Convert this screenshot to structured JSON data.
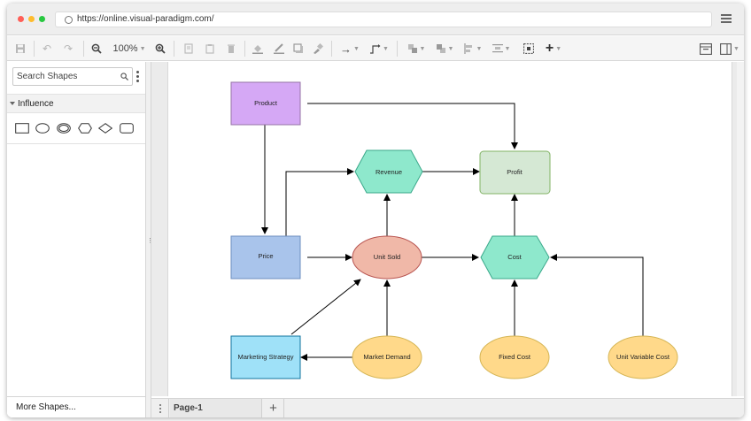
{
  "browser": {
    "url": "https://online.visual-paradigm.com/",
    "dot_colors": [
      "#ff5f57",
      "#febc2e",
      "#28c840"
    ]
  },
  "toolbar": {
    "zoom_level": "100%",
    "icons": [
      "save-icon",
      "undo-icon",
      "redo-icon",
      "zoom-out-icon",
      "zoom-in-icon",
      "copy-icon",
      "paste-icon",
      "delete-icon",
      "fill-color-icon",
      "line-color-icon",
      "shadow-icon",
      "format-painter-icon",
      "connector-icon",
      "waypoint-icon",
      "to-front-icon",
      "to-back-icon",
      "align-icon",
      "distribute-icon",
      "select-all-icon",
      "insert-icon",
      "format-panel-icon",
      "outline-panel-icon"
    ]
  },
  "sidebar": {
    "search_placeholder": "Search Shapes",
    "section_title": "Influence",
    "palette_shapes": [
      "rectangle",
      "ellipse",
      "double-ellipse",
      "hexagon",
      "diamond",
      "rounded-rectangle"
    ],
    "more_shapes_label": "More Shapes..."
  },
  "pages": {
    "tabs": [
      {
        "label": "Page-1"
      }
    ],
    "add_label": "+"
  },
  "diagram": {
    "colors": {
      "product": "#d5a8f5",
      "product_stroke": "#9673a6",
      "revenue": "#8ee8cc",
      "revenue_stroke": "#3aa88a",
      "profit": "#d5e8d4",
      "profit_stroke": "#82b366",
      "price": "#a9c4eb",
      "price_stroke": "#6c8ebf",
      "unit_sold": "#f0b8a8",
      "unit_sold_stroke": "#b85450",
      "cost": "#8ee8cc",
      "cost_stroke": "#3aa88a",
      "marketing": "#9fe1f8",
      "marketing_stroke": "#10739e",
      "yellow": "#ffd98a",
      "yellow_stroke": "#d6b656"
    },
    "nodes": [
      {
        "id": "product",
        "label": "Product"
      },
      {
        "id": "revenue",
        "label": "Revenue"
      },
      {
        "id": "profit",
        "label": "Profit"
      },
      {
        "id": "price",
        "label": "Price"
      },
      {
        "id": "unit_sold",
        "label": "Unit Sold"
      },
      {
        "id": "cost",
        "label": "Cost"
      },
      {
        "id": "marketing",
        "label": "Marketing Strategy"
      },
      {
        "id": "market_demand",
        "label": "Market Demand"
      },
      {
        "id": "fixed_cost",
        "label": "Fixed Cost"
      },
      {
        "id": "unit_variable_cost",
        "label": "Unit Variable Cost"
      }
    ]
  }
}
